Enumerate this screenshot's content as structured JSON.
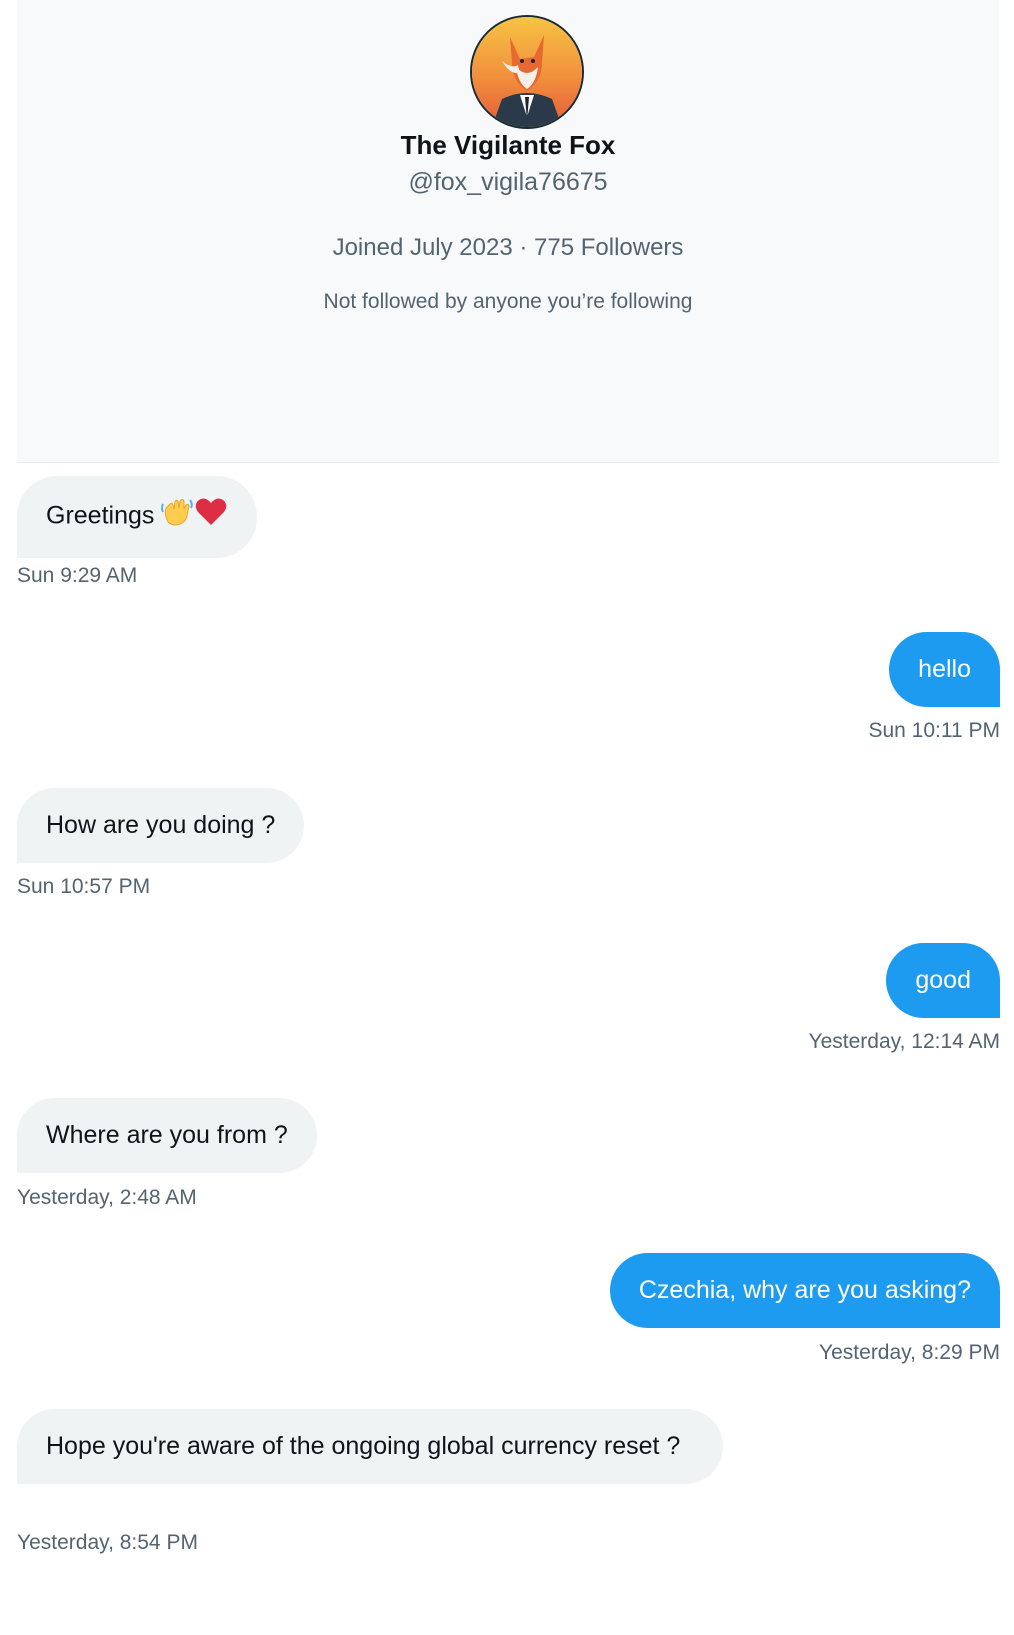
{
  "profile": {
    "name": "The Vigilante Fox",
    "handle": "@fox_vigila76675",
    "meta": "Joined July 2023 · 775 Followers",
    "note": "Not followed by anyone you’re following"
  },
  "messages": [
    {
      "direction": "in",
      "text": "Greetings",
      "emoji": [
        "waving-hand-icon",
        "red-heart-icon"
      ],
      "time": "Sun 9:29 AM"
    },
    {
      "direction": "out",
      "text": "hello",
      "time": "Sun 10:11 PM"
    },
    {
      "direction": "in",
      "text": "How are you doing ?",
      "time": "Sun 10:57 PM"
    },
    {
      "direction": "out",
      "text": "good",
      "time": "Yesterday, 12:14 AM"
    },
    {
      "direction": "in",
      "text": "Where are you from ?",
      "time": "Yesterday, 2:48 AM"
    },
    {
      "direction": "out",
      "text": "Czechia, why are you asking?",
      "time": "Yesterday, 8:29 PM"
    },
    {
      "direction": "in",
      "text": "Hope you're aware of the ongoing global currency reset ?",
      "time": "Yesterday, 8:54 PM"
    }
  ],
  "colors": {
    "outgoing_bubble": "#1d9bf0",
    "incoming_bubble": "#eff3f4",
    "secondary_text": "#536471"
  }
}
